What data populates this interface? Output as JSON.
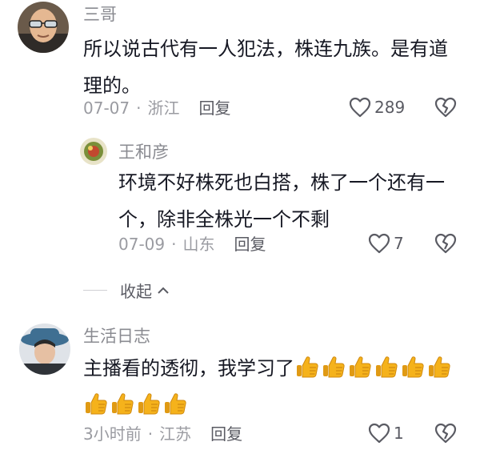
{
  "comments": [
    {
      "username": "三哥",
      "text": "所以说古代有一人犯法，株连九族。是有道理的。",
      "date": "07-07",
      "location": "浙江",
      "reply_label": "回复",
      "likes": "289"
    },
    {
      "username": "王和彦",
      "text": "环境不好株死也白搭，株了一个还有一个，除非全株光一个不剩",
      "date": "07-09",
      "location": "山东",
      "reply_label": "回复",
      "likes": "7"
    },
    {
      "username": "生活日志",
      "text": "主播看的透彻，我学习了",
      "emoji_count": 10,
      "emoji_icon": "thumbs-up-emoji",
      "date": "3小时前",
      "location": "江苏",
      "reply_label": "回复",
      "likes": "1"
    }
  ],
  "collapse_label": "收起",
  "separator": "·",
  "colors": {
    "text": "#161823",
    "muted": "#9a9ba1",
    "name": "#8a8b91",
    "thumb": "#f5b21b"
  }
}
